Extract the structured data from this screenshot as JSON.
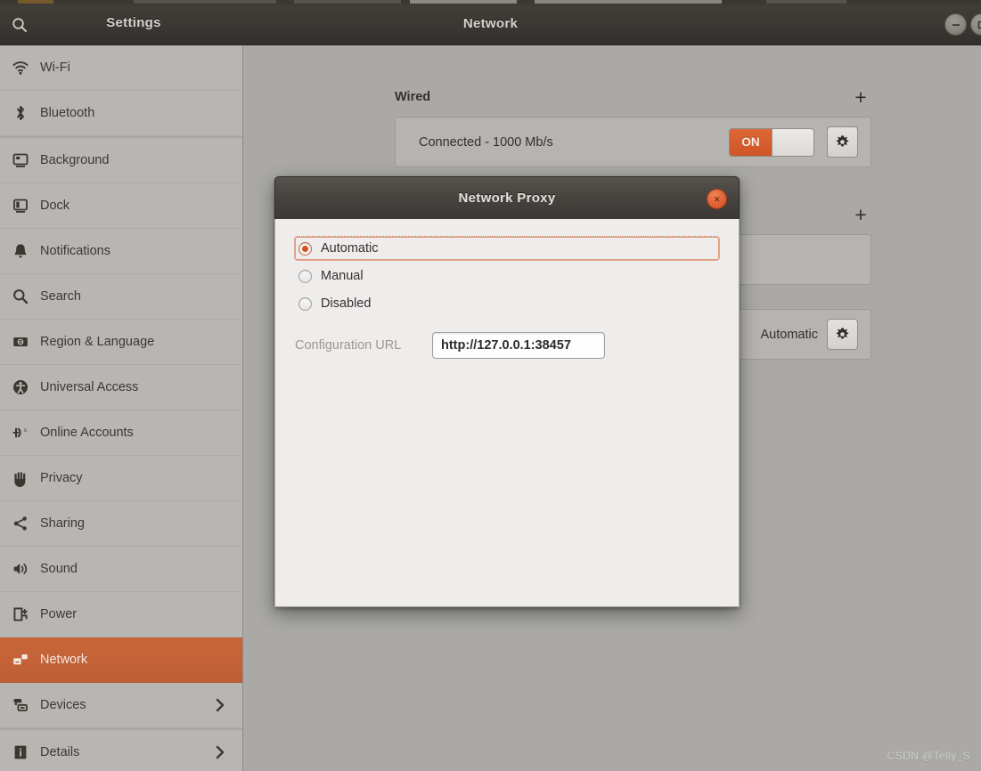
{
  "header": {
    "search_icon": "search-icon",
    "settings_title": "Settings",
    "page_title": "Network",
    "minimize_label": "–",
    "maximize_label": "□"
  },
  "sidebar": {
    "items": [
      {
        "label": "Wi-Fi",
        "icon": "wifi-icon",
        "selected": false,
        "chevron": false
      },
      {
        "label": "Bluetooth",
        "icon": "bluetooth-icon",
        "selected": false,
        "chevron": false
      },
      {
        "label": "Background",
        "icon": "background-icon",
        "selected": false,
        "chevron": false
      },
      {
        "label": "Dock",
        "icon": "dock-icon",
        "selected": false,
        "chevron": false
      },
      {
        "label": "Notifications",
        "icon": "bell-icon",
        "selected": false,
        "chevron": false
      },
      {
        "label": "Search",
        "icon": "search-icon",
        "selected": false,
        "chevron": false
      },
      {
        "label": "Region & Language",
        "icon": "region-language-icon",
        "selected": false,
        "chevron": false
      },
      {
        "label": "Universal Access",
        "icon": "accessibility-icon",
        "selected": false,
        "chevron": false
      },
      {
        "label": "Online Accounts",
        "icon": "online-accounts-icon",
        "selected": false,
        "chevron": false
      },
      {
        "label": "Privacy",
        "icon": "hand-icon",
        "selected": false,
        "chevron": false
      },
      {
        "label": "Sharing",
        "icon": "share-icon",
        "selected": false,
        "chevron": false
      },
      {
        "label": "Sound",
        "icon": "speaker-icon",
        "selected": false,
        "chevron": false
      },
      {
        "label": "Power",
        "icon": "power-battery-icon",
        "selected": false,
        "chevron": false
      },
      {
        "label": "Network",
        "icon": "network-icon",
        "selected": true,
        "chevron": false
      },
      {
        "label": "Devices",
        "icon": "devices-icon",
        "selected": false,
        "chevron": true
      },
      {
        "label": "Details",
        "icon": "info-icon",
        "selected": false,
        "chevron": true
      }
    ]
  },
  "main": {
    "sections": [
      {
        "title": "Wired",
        "add_label": "+",
        "row_label": "Connected - 1000 Mb/s",
        "toggle_state": "ON",
        "gear_icon": "gear-icon"
      },
      {
        "title": "",
        "add_label": "+",
        "row_label": "",
        "toggle_state": "",
        "gear_icon": ""
      },
      {
        "title": "",
        "add_label": "",
        "row_label": "Automatic",
        "toggle_state": "",
        "gear_icon": "gear-icon"
      }
    ]
  },
  "dialog": {
    "title": "Network Proxy",
    "close_label": "×",
    "options": [
      {
        "label": "Automatic",
        "checked": true,
        "focused": true
      },
      {
        "label": "Manual",
        "checked": false,
        "focused": false
      },
      {
        "label": "Disabled",
        "checked": false,
        "focused": false
      }
    ],
    "config_url_label": "Configuration URL",
    "config_url_value": "http://127.0.0.1:38457"
  },
  "watermark": {
    "text": "CSDN @Telly_S"
  },
  "colors": {
    "accent_orange": "#c0642d",
    "toggle_on": "#cf5526",
    "close_button": "#e2653a",
    "sidebar_bg": "#b8b6b3",
    "content_bg": "#aaa9a6",
    "dialog_bg": "#eeedec",
    "headerbar_bg": "#3b3733"
  }
}
